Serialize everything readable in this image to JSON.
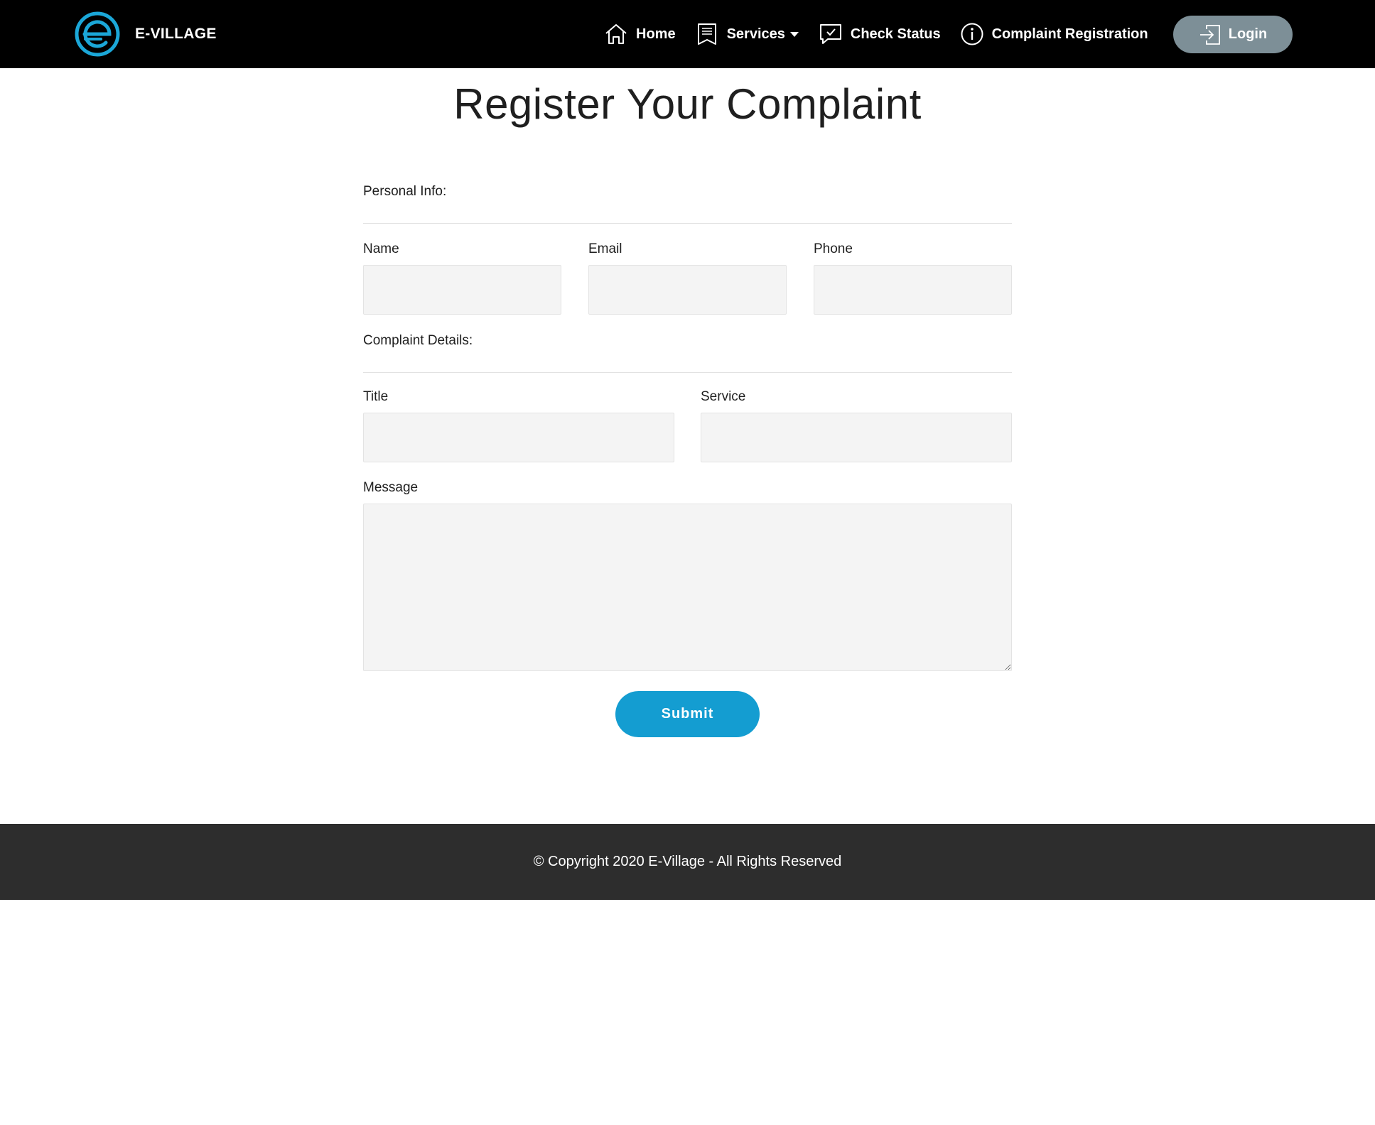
{
  "colors": {
    "header_bg": "#000000",
    "accent": "#149dd1",
    "login_bg": "#7d8f97",
    "field_bg": "#f4f4f4",
    "footer_bg": "#2d2d2d"
  },
  "header": {
    "brand": "E-VILLAGE",
    "logo_icon": "e-village-logo",
    "nav": [
      {
        "label": "Home",
        "icon": "home-icon"
      },
      {
        "label": "Services",
        "icon": "bookmark-list-icon",
        "has_dropdown": true
      },
      {
        "label": "Check Status",
        "icon": "chat-check-icon"
      },
      {
        "label": "Complaint Registration",
        "icon": "info-icon"
      }
    ],
    "login": {
      "label": "Login",
      "icon": "sign-in-icon"
    }
  },
  "main": {
    "title": "Register Your Complaint",
    "personal_section": "Personal Info:",
    "personal_fields": {
      "name": {
        "label": "Name",
        "value": ""
      },
      "email": {
        "label": "Email",
        "value": ""
      },
      "phone": {
        "label": "Phone",
        "value": ""
      }
    },
    "complaint_section": "Complaint Details:",
    "complaint_fields": {
      "title": {
        "label": "Title",
        "value": ""
      },
      "service": {
        "label": "Service",
        "value": ""
      },
      "message": {
        "label": "Message",
        "value": ""
      }
    },
    "submit_label": "Submit"
  },
  "footer": {
    "text": "© Copyright 2020 E-Village - All Rights Reserved"
  }
}
